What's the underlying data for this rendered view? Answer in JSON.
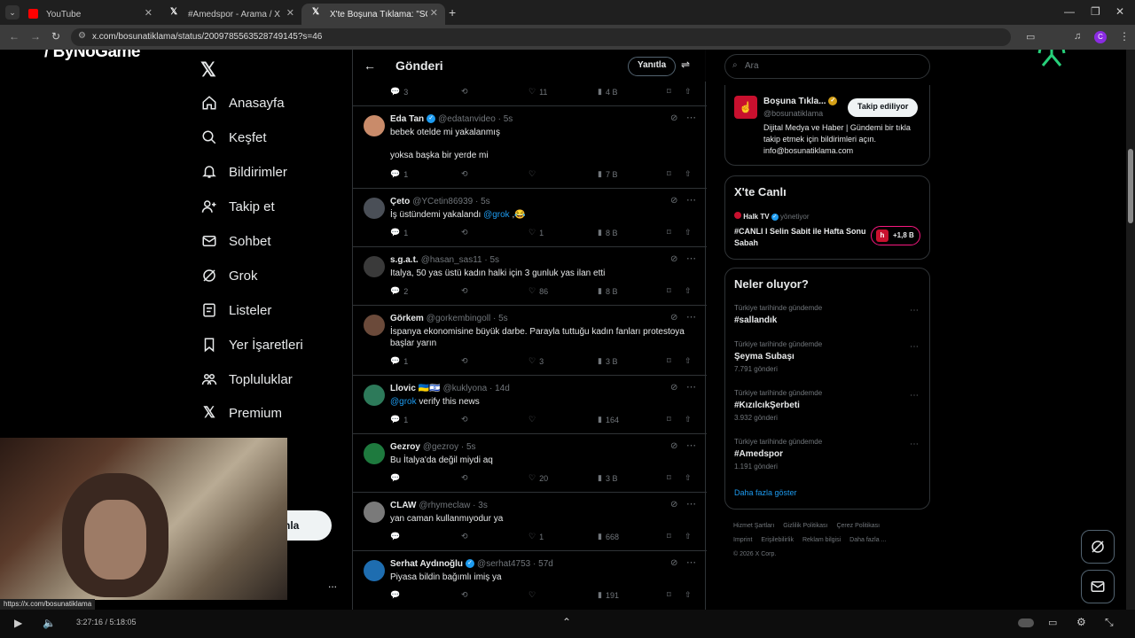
{
  "browser": {
    "tabs": [
      {
        "title": "YouTube",
        "color": "#ff0000"
      },
      {
        "title": "#Amedspor - Arama / X",
        "color": "#ffffff"
      },
      {
        "title": "X'te Boşuna Tıklama: \"SON DA",
        "color": "#ffffff"
      }
    ],
    "url": "x.com/bosunatiklama/status/2009785563528749145?s=46",
    "new_tab_label": "+"
  },
  "overlay": {
    "brand": "ByNoGame"
  },
  "sidebar": {
    "items": [
      {
        "label": "Anasayfa",
        "icon": "home-icon"
      },
      {
        "label": "Keşfet",
        "icon": "search-icon"
      },
      {
        "label": "Bildirimler",
        "icon": "bell-icon"
      },
      {
        "label": "Takip et",
        "icon": "follow-icon"
      },
      {
        "label": "Sohbet",
        "icon": "mail-icon"
      },
      {
        "label": "Grok",
        "icon": "grok-icon"
      },
      {
        "label": "Listeler",
        "icon": "list-icon"
      },
      {
        "label": "Yer İşaretleri",
        "icon": "bookmark-icon"
      },
      {
        "label": "Topluluklar",
        "icon": "communities-icon"
      },
      {
        "label": "Premium",
        "icon": "x-icon"
      }
    ],
    "post_button": "nla",
    "more": "..."
  },
  "feed": {
    "title": "Gönderi",
    "reply_button": "Yanıtla",
    "top_actions": {
      "replies": "3",
      "likes": "11",
      "views": "4 B"
    },
    "tweets": [
      {
        "name": "Eda Tan",
        "verified": true,
        "handle": "@edatanvideo",
        "time": "5s",
        "text": "bebek otelde mi yakalanmış\n\nyoksa başka bir yerde mi",
        "replies": "1",
        "retweets": "",
        "likes": "",
        "views": "7 B"
      },
      {
        "name": "Çeto",
        "verified": false,
        "handle": "@YCetin86939",
        "time": "5s",
        "text_before": "İş üstündemi yakalandı ",
        "mention": "@grok",
        "text_after": " ,😂",
        "replies": "1",
        "retweets": "",
        "likes": "1",
        "views": "8 B"
      },
      {
        "name": "s.g.a.t.",
        "verified": false,
        "handle": "@hasan_sas11",
        "time": "5s",
        "text": "Italya, 50 yas üstü kadın halki için 3 gunluk yas ilan etti",
        "replies": "2",
        "retweets": "",
        "likes": "86",
        "views": "8 B"
      },
      {
        "name": "Görkem",
        "verified": false,
        "handle": "@gorkembingoll",
        "time": "5s",
        "text": "İspanya ekonomisine büyük darbe. Parayla tuttuğu kadın fanları protestoya başlar yarın",
        "replies": "1",
        "retweets": "",
        "likes": "3",
        "views": "3 B"
      },
      {
        "name": "Llovic 🇺🇦🇮🇱",
        "verified": false,
        "handle": "@kuklyona",
        "time": "14d",
        "mention": "@grok",
        "text_after": " verify this news",
        "replies": "1",
        "retweets": "",
        "likes": "",
        "views": "164"
      },
      {
        "name": "Gezroy",
        "verified": false,
        "handle": "@gezroy",
        "time": "5s",
        "text": "Bu İtalya'da değil miydi aq",
        "replies": "",
        "retweets": "",
        "likes": "20",
        "views": "3 B"
      },
      {
        "name": "CLAW",
        "verified": false,
        "handle": "@rhymeclaw",
        "time": "3s",
        "text": "yan caman kullanmıyodur ya",
        "replies": "",
        "retweets": "",
        "likes": "1",
        "views": "668"
      },
      {
        "name": "Serhat Aydınoğlu",
        "verified": true,
        "handle": "@serhat4753",
        "time": "57d",
        "text": "Piyasa bildin bağımlı imiş ya",
        "replies": "",
        "retweets": "",
        "likes": "",
        "views": "191"
      }
    ]
  },
  "right": {
    "search_placeholder": "Ara",
    "profile": {
      "name": "Boşuna Tıkla...",
      "handle": "@bosunatiklama",
      "follow": "Takip ediliyor",
      "bio": "Dijital Medya ve Haber | Gündemi bir tıkla takip etmek için bildirimleri açın. info@bosunatiklama.com"
    },
    "live": {
      "title": "X'te Canlı",
      "host": "Halk TV",
      "host_role": "yönetiyor",
      "stream": "#CANLI I Selin Sabit ile Hafta Sonu Sabah",
      "listeners": "+1,8 B"
    },
    "trends": {
      "title": "Neler oluyor?",
      "items": [
        {
          "meta": "Türkiye tarihinde gündemde",
          "name": "#sallandık",
          "count": ""
        },
        {
          "meta": "Türkiye tarihinde gündemde",
          "name": "Şeyma Subaşı",
          "count": "7.791 gönderi"
        },
        {
          "meta": "Türkiye tarihinde gündemde",
          "name": "#KızılcıkŞerbeti",
          "count": "3.932 gönderi"
        },
        {
          "meta": "Türkiye tarihinde gündemde",
          "name": "#Amedspor",
          "count": "1.191 gönderi"
        }
      ],
      "show_more": "Daha fazla göster"
    },
    "footer": [
      "Hizmet Şartları",
      "Gizlilik Politikası",
      "Çerez Politikası",
      "Imprint",
      "Erişilebilirlik",
      "Reklam bilgisi",
      "Daha fazla ...",
      "© 2026 X Corp."
    ]
  },
  "status_url": "https://x.com/bosunatiklama",
  "player": {
    "time": "3:27:16 / 5:18:05"
  }
}
